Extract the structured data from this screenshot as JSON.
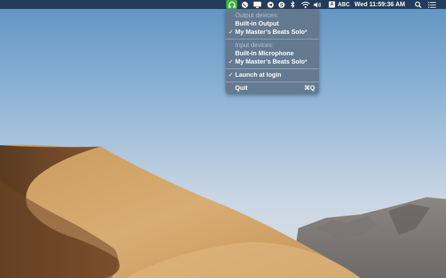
{
  "menubar": {
    "status_icons": [
      {
        "name": "audio-switcher-icon",
        "active": true
      },
      {
        "name": "viber-icon"
      },
      {
        "name": "display-icon"
      },
      {
        "name": "telegram-icon"
      },
      {
        "name": "skype-icon"
      },
      {
        "name": "bluetooth-icon"
      },
      {
        "name": "wifi-icon"
      },
      {
        "name": "volume-icon"
      },
      {
        "name": "input-source-icon"
      }
    ],
    "input_source_label": "ABC",
    "input_source_glyph": "A",
    "clock": "Wed 11:59:36 AM",
    "spotlight_icon": "search-icon",
    "notification_icon": "list-icon",
    "active_color": "#3fb247"
  },
  "menu": {
    "output_header": "Output devices:",
    "output_items": [
      {
        "label": "Built-in Output",
        "checked": false
      },
      {
        "label": "My Master’s Beats Solo³",
        "checked": true
      }
    ],
    "input_header": "Input devices:",
    "input_items": [
      {
        "label": "Built-in Microphone",
        "checked": false
      },
      {
        "label": "My Master’s Beats Solo³",
        "checked": true
      }
    ],
    "launch_at_login": {
      "label": "Launch at login",
      "checked": true
    },
    "quit": {
      "label": "Quit",
      "shortcut": "⌘Q"
    },
    "check_glyph": "✓"
  }
}
